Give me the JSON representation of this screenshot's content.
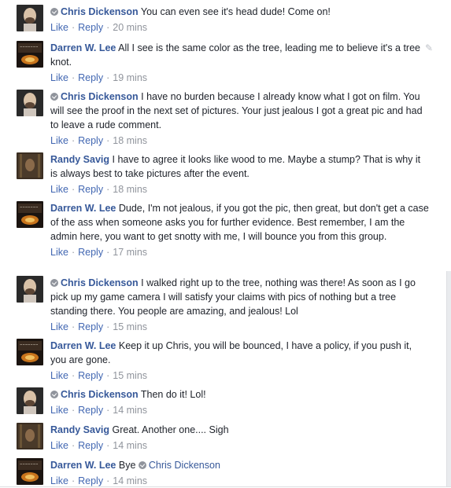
{
  "comments": [
    {
      "author": "Chris Dickenson",
      "verified": true,
      "text": "You can even see it's head dude! Come on!",
      "like": "Like",
      "reply": "Reply",
      "time": "20 mins",
      "avatar": "chris"
    },
    {
      "author": "Darren W. Lee",
      "verified": false,
      "text": "All I see is the same color as the tree, leading me to believe it's a tree knot.",
      "like": "Like",
      "reply": "Reply",
      "time": "19 mins",
      "avatar": "darren",
      "edit_icon": "pencil-icon"
    },
    {
      "author": "Chris Dickenson",
      "verified": true,
      "text": "I have no burden because I already know what I got on film. You will see the proof in the next set of pictures. Your just jealous I got a great pic and had to leave a rude comment.",
      "like": "Like",
      "reply": "Reply",
      "time": "18 mins",
      "avatar": "chris"
    },
    {
      "author": "Randy Savig",
      "verified": false,
      "text": "I have to agree it looks like wood to me. Maybe a stump? That is why it is always best to take pictures after the event.",
      "like": "Like",
      "reply": "Reply",
      "time": "18 mins",
      "avatar": "randy"
    },
    {
      "author": "Darren W. Lee",
      "verified": false,
      "text": "Dude, I'm not jealous, if you got the pic, then great, but don't get a case of the ass when someone asks you for further evidence. Best remember, I am the admin here, you want to get snotty with me, I will bounce you from this group.",
      "like": "Like",
      "reply": "Reply",
      "time": "17 mins",
      "avatar": "darren"
    },
    {
      "author": "Chris Dickenson",
      "verified": true,
      "text": "I walked right up to the tree, nothing was there! As soon as I go pick up my game camera I will satisfy your claims with pics of nothing but a tree standing there. You people are amazing, and jealous! Lol",
      "like": "Like",
      "reply": "Reply",
      "time": "15 mins",
      "avatar": "chris"
    },
    {
      "author": "Darren W. Lee",
      "verified": false,
      "text": "Keep it up Chris, you will be bounced, I have a policy, if you push it, you are gone.",
      "like": "Like",
      "reply": "Reply",
      "time": "15 mins",
      "avatar": "darren"
    },
    {
      "author": "Chris Dickenson",
      "verified": true,
      "text": "Then do it! Lol!",
      "like": "Like",
      "reply": "Reply",
      "time": "14 mins",
      "avatar": "chris"
    },
    {
      "author": "Randy Savig",
      "verified": false,
      "text": "Great. Another one.... Sigh",
      "like": "Like",
      "reply": "Reply",
      "time": "14 mins",
      "avatar": "randy"
    },
    {
      "author": "Darren W. Lee",
      "verified": false,
      "text": "Bye",
      "mention": "Chris Dickenson",
      "mention_verified": true,
      "like": "Like",
      "reply": "Reply",
      "time": "14 mins",
      "avatar": "darren"
    }
  ],
  "separator": "·",
  "colors": {
    "link": "#365899",
    "action": "#4267b2",
    "meta": "#90949c",
    "text": "#1d2129"
  }
}
